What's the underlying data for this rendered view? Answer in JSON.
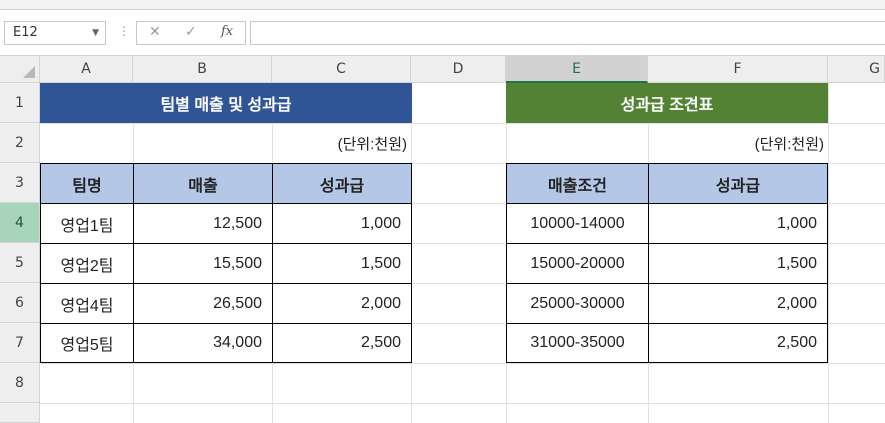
{
  "name_box": {
    "value": "E12"
  },
  "formula_bar": {
    "cancel_glyph": "✕",
    "enter_glyph": "✓",
    "fx_label": "fx",
    "content": ""
  },
  "columns": [
    "A",
    "B",
    "C",
    "D",
    "E",
    "F",
    "G"
  ],
  "rows": [
    "1",
    "2",
    "3",
    "4",
    "5",
    "6",
    "7",
    "8"
  ],
  "sheet": {
    "left_table": {
      "title": "팀별 매출 및 성과급",
      "unit": "(단위:천원)",
      "headers": [
        "팀명",
        "매출",
        "성과급"
      ],
      "rows": [
        [
          "영업1팀",
          "12,500",
          "1,000"
        ],
        [
          "영업2팀",
          "15,500",
          "1,500"
        ],
        [
          "영업4팀",
          "26,500",
          "2,000"
        ],
        [
          "영업5팀",
          "34,000",
          "2,500"
        ]
      ]
    },
    "right_table": {
      "title": "성과급 조견표",
      "unit": "(단위:천원)",
      "headers": [
        "매출조건",
        "성과급"
      ],
      "rows": [
        [
          "10000-14000",
          "1,000"
        ],
        [
          "15000-20000",
          "1,500"
        ],
        [
          "25000-30000",
          "2,000"
        ],
        [
          "31000-35000",
          "2,500"
        ]
      ]
    }
  },
  "colors": {
    "title_blue": "#2f5597",
    "title_green": "#548235",
    "header_fill": "#b4c7e7",
    "selection": "#217346"
  }
}
